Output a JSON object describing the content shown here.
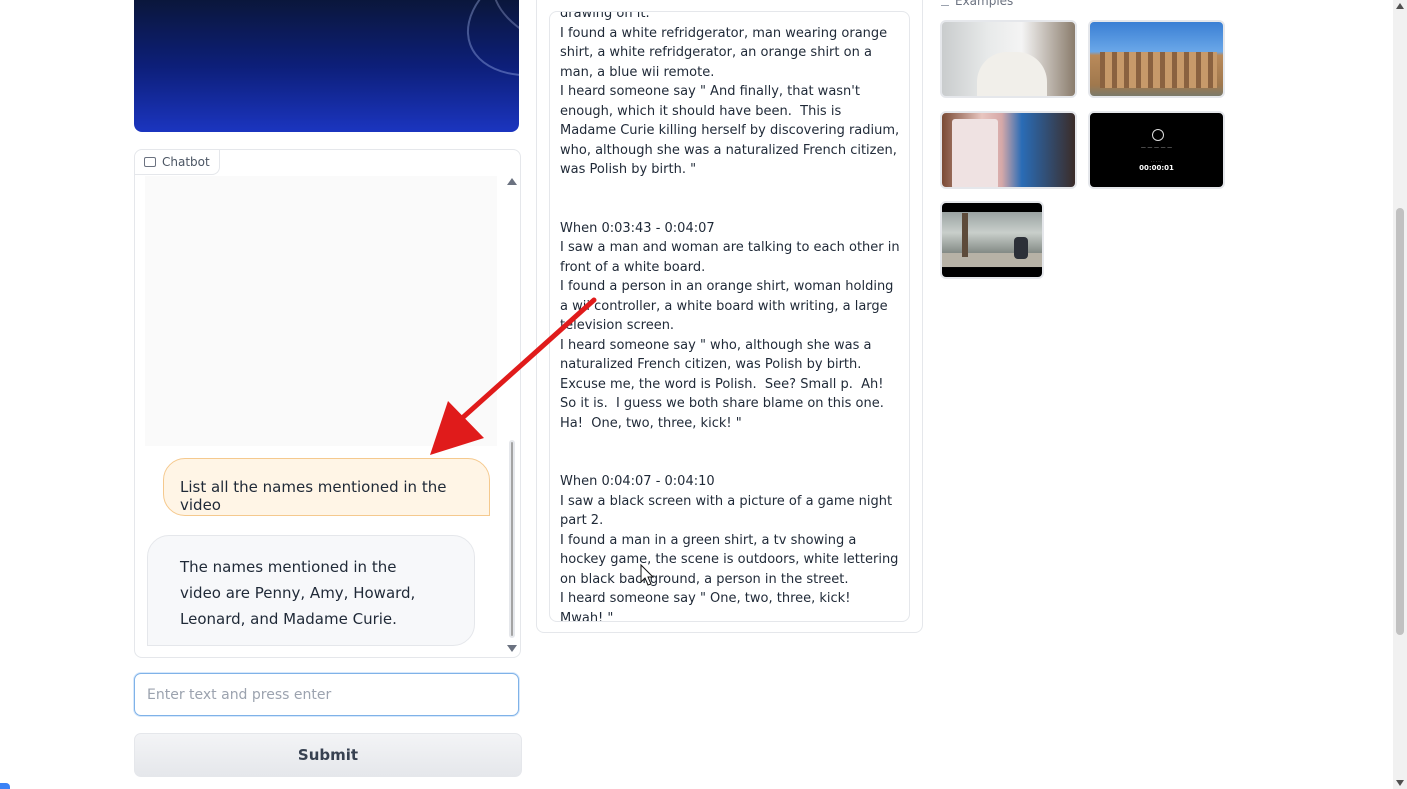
{
  "chatbot": {
    "label": "Chatbot",
    "messages": [
      {
        "role": "user",
        "text": "List all the names mentioned in the video"
      },
      {
        "role": "bot",
        "text": "The names mentioned in the video are Penny, Amy, Howard, Leonard, and Madame Curie."
      }
    ]
  },
  "input": {
    "placeholder": "Enter text and press enter",
    "value": ""
  },
  "submit_label": "Submit",
  "output": {
    "text": "drawing on it.\nI found a white refridgerator, man wearing orange shirt, a white refridgerator, an orange shirt on a man, a blue wii remote.\nI heard someone say \" And finally, that wasn't enough, which it should have been.  This is Madame Curie killing herself by discovering radium,  who, although she was a naturalized French citizen, was Polish by birth. \"\n\n\nWhen 0:03:43 - 0:04:07\nI saw a man and woman are talking to each other in front of a white board.\nI found a person in an orange shirt, woman holding a wii controller, a white board with writing, a large television screen.\nI heard someone say \" who, although she was a naturalized French citizen, was Polish by birth.  Excuse me, the word is Polish.  See? Small p.  Ah!  So it is.  I guess we both share blame on this one.  Ha!  One, two, three, kick! \"\n\n\nWhen 0:04:07 - 0:04:10\nI saw a black screen with a picture of a game night part 2.\nI found a man in a green shirt, a tv showing a hockey game, the scene is outdoors, white lettering on black background, a person in the street.\nI heard someone say \" One, two, three, kick!  Mwah! \""
  },
  "examples": {
    "label": "Examples",
    "items": [
      {
        "name": "bedroom-clip"
      },
      {
        "name": "colosseum-clip"
      },
      {
        "name": "fridge-clip"
      },
      {
        "name": "game-night-clip",
        "timer": "00:00:01"
      },
      {
        "name": "street-clip"
      }
    ]
  },
  "colors": {
    "user_bubble": "#fff5e6",
    "user_bubble_border": "#f5c98e",
    "input_focus_border": "#7fb2e8",
    "annotation_arrow": "#e01b1b"
  }
}
